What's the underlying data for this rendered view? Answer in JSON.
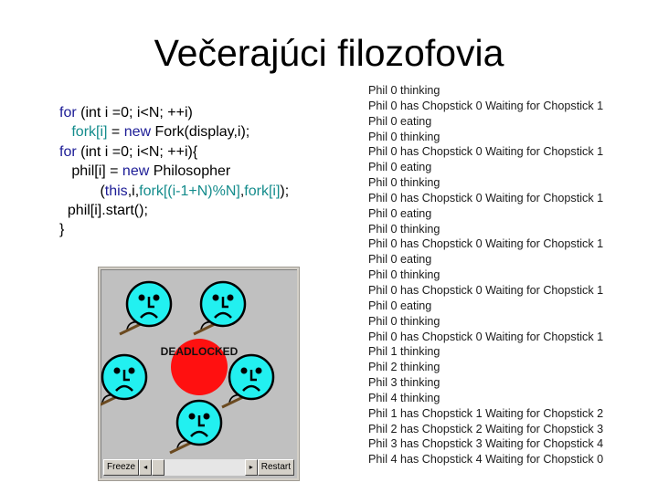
{
  "slide": {
    "title": "Večerajúci filozofovia"
  },
  "code": {
    "lines": [
      [
        {
          "t": "for",
          "c": "kw"
        },
        {
          "t": " (int i =0; i<N; ++i)",
          "c": ""
        }
      ],
      [
        {
          "t": "   ",
          "c": ""
        },
        {
          "t": "fork[i]",
          "c": "hl"
        },
        {
          "t": " = ",
          "c": ""
        },
        {
          "t": "new",
          "c": "kw"
        },
        {
          "t": " Fork(display,i);",
          "c": ""
        }
      ],
      [
        {
          "t": "for",
          "c": "kw"
        },
        {
          "t": " (int i =0; i<N; ++i){",
          "c": ""
        }
      ],
      [
        {
          "t": "   phil[i] = ",
          "c": ""
        },
        {
          "t": "new",
          "c": "kw"
        },
        {
          "t": " Philosopher",
          "c": ""
        }
      ],
      [
        {
          "t": "          (",
          "c": ""
        },
        {
          "t": "this",
          "c": "kw"
        },
        {
          "t": ",i,",
          "c": ""
        },
        {
          "t": "fork[(i-1+N)%N]",
          "c": "hl"
        },
        {
          "t": ",",
          "c": ""
        },
        {
          "t": "fork[i]",
          "c": "hl"
        },
        {
          "t": ");",
          "c": ""
        }
      ],
      [
        {
          "t": "  phil[i].start();",
          "c": ""
        }
      ],
      [
        {
          "t": "}",
          "c": ""
        }
      ]
    ]
  },
  "applet": {
    "status_label": "DEADLOCKED",
    "freeze_label": "Freeze",
    "restart_label": "Restart",
    "scroll_left_icon": "◂",
    "scroll_right_icon": "▸",
    "colors": {
      "face": "#22f0f0",
      "deadlock": "#ff1010",
      "chopstick": "#6b4a20",
      "background": "#c0c0c0"
    },
    "philosophers": [
      {
        "id": 0,
        "mood": "sad"
      },
      {
        "id": 1,
        "mood": "sad"
      },
      {
        "id": 2,
        "mood": "sad"
      },
      {
        "id": 3,
        "mood": "sad"
      },
      {
        "id": 4,
        "mood": "sad"
      }
    ]
  },
  "log": {
    "lines": [
      "Phil 0 thinking",
      "Phil 0 has Chopstick 0 Waiting for Chopstick 1",
      "Phil 0 eating",
      "Phil 0 thinking",
      "Phil 0 has Chopstick 0 Waiting for Chopstick 1",
      "Phil 0 eating",
      "Phil 0 thinking",
      "Phil 0 has Chopstick 0 Waiting for Chopstick 1",
      "Phil 0 eating",
      "Phil 0 thinking",
      "Phil 0 has Chopstick 0 Waiting for Chopstick 1",
      "Phil 0 eating",
      "Phil 0 thinking",
      "Phil 0 has Chopstick 0 Waiting for Chopstick 1",
      "Phil 0 eating",
      "Phil 0 thinking",
      "Phil 0 has Chopstick 0 Waiting for Chopstick 1",
      "Phil 1 thinking",
      "Phil 2 thinking",
      "Phil 3 thinking",
      "Phil 4 thinking",
      "Phil 1 has Chopstick 1 Waiting for Chopstick 2",
      "Phil 2 has Chopstick 2 Waiting for Chopstick 3",
      "Phil 3 has Chopstick 3 Waiting for Chopstick 4",
      "Phil 4 has Chopstick 4 Waiting for Chopstick 0"
    ]
  }
}
